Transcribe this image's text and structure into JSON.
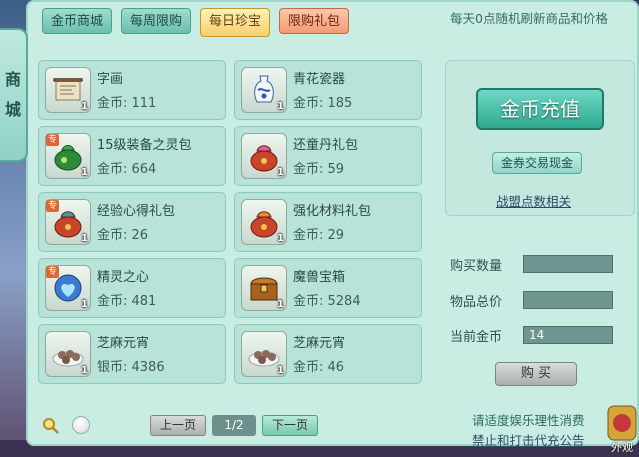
{
  "side_tab": {
    "chars": [
      "商",
      "城"
    ]
  },
  "tabs": [
    {
      "label": "金币商城",
      "active": false
    },
    {
      "label": "每周限购",
      "active": false
    },
    {
      "label": "每日珍宝",
      "active": true
    },
    {
      "label": "限购礼包",
      "active": false
    }
  ],
  "notice_top": "每天0点随机刷新商品和价格",
  "items": [
    {
      "name": "字画",
      "price": "金币: 111",
      "qty": "1",
      "tag": "",
      "icon": "scroll-icon"
    },
    {
      "name": "青花瓷器",
      "price": "金币: 185",
      "qty": "1",
      "tag": "",
      "icon": "vase-icon"
    },
    {
      "name": "15级装备之灵包",
      "price": "金币: 664",
      "qty": "1",
      "tag": "专",
      "icon": "green-bag-icon"
    },
    {
      "name": "还童丹礼包",
      "price": "金币: 59",
      "qty": "1",
      "tag": "",
      "icon": "red-bag-icon"
    },
    {
      "name": "经验心得礼包",
      "price": "金币: 26",
      "qty": "1",
      "tag": "专",
      "icon": "red-bag-icon"
    },
    {
      "name": "强化材料礼包",
      "price": "金币: 29",
      "qty": "1",
      "tag": "",
      "icon": "red-bag-icon"
    },
    {
      "name": "精灵之心",
      "price": "金币: 481",
      "qty": "1",
      "tag": "专",
      "icon": "spirit-heart-icon"
    },
    {
      "name": "魔兽宝箱",
      "price": "金币: 5284",
      "qty": "1",
      "tag": "",
      "icon": "treasure-chest-icon"
    },
    {
      "name": "芝麻元宵",
      "price": "银币: 4386",
      "qty": "1",
      "tag": "",
      "icon": "rice-ball-icon"
    },
    {
      "name": "芝麻元宵",
      "price": "金币: 46",
      "qty": "1",
      "tag": "",
      "icon": "rice-ball-icon"
    }
  ],
  "right_panel": {
    "recharge": "金币充值",
    "voucher": "金券交易现金",
    "alliance": "战盟点数相关"
  },
  "form": {
    "qty_label": "购买数量",
    "total_label": "物品总价",
    "current_label": "当前金币",
    "current_value": "14",
    "buy": "购 买"
  },
  "pager": {
    "prev": "上一页",
    "page": "1/2",
    "next": "下一页"
  },
  "notice_bottom1": "请适度娱乐理性消费",
  "notice_bottom2": "禁止和打击代充公告",
  "appearance_label": "外观"
}
